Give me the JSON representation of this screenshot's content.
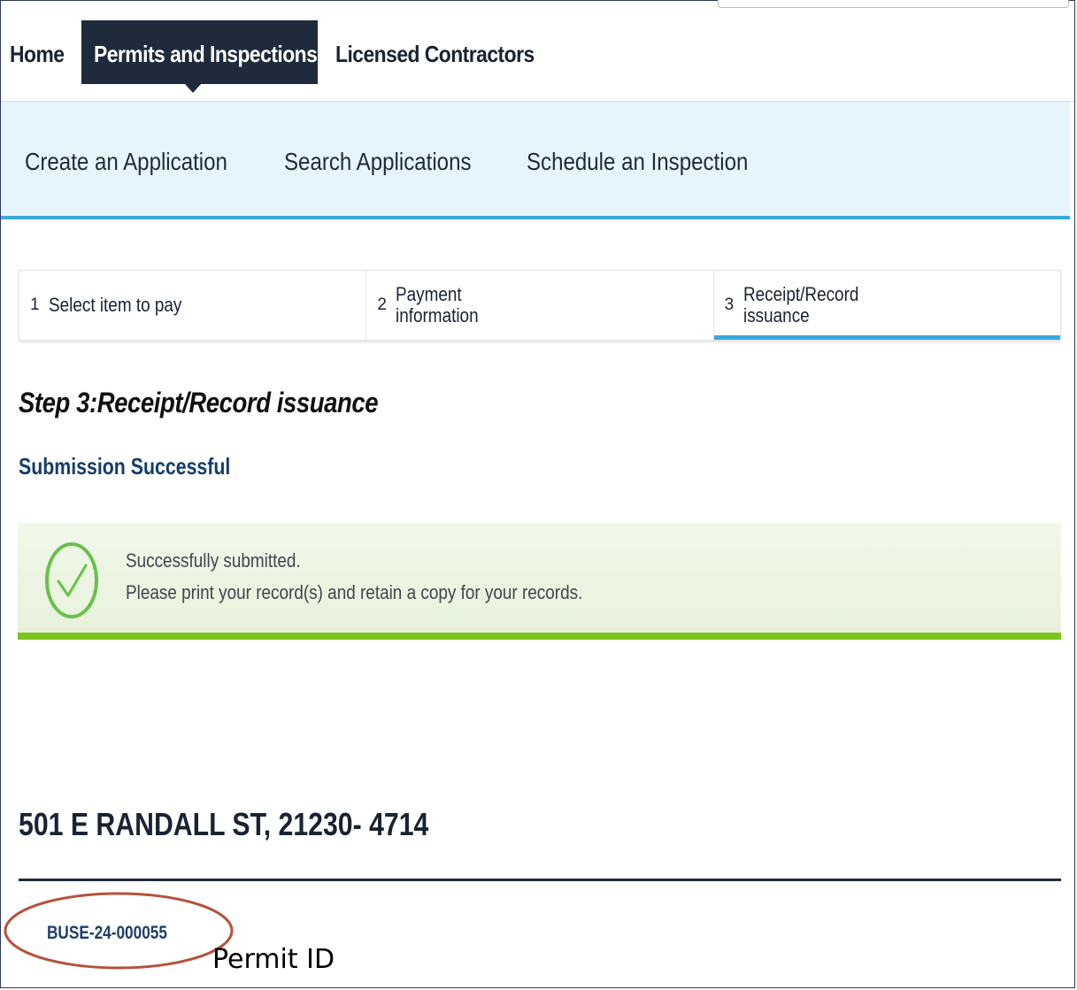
{
  "top_nav": {
    "items": [
      {
        "label": "Home"
      },
      {
        "label": "Permits and Inspections"
      },
      {
        "label": "Licensed Contractors"
      }
    ]
  },
  "sub_nav": {
    "items": [
      {
        "label": "Create an Application"
      },
      {
        "label": "Search Applications"
      },
      {
        "label": "Schedule an Inspection"
      }
    ]
  },
  "steps": [
    {
      "number": "1",
      "label": "Select item to pay"
    },
    {
      "number": "2",
      "label": "Payment information"
    },
    {
      "number": "3",
      "label": "Receipt/Record issuance"
    }
  ],
  "step_title": "Step 3:Receipt/Record issuance",
  "success_heading": "Submission Successful",
  "success_message": {
    "line1": "Successfully submitted.",
    "line2": "Please print your record(s) and retain a copy for your records."
  },
  "address": "501 E RANDALL ST, 21230- 4714",
  "permit_id": "BUSE-24-000055",
  "annotation": {
    "label": "Permit ID"
  },
  "colors": {
    "nav_active_bg": "#1f2a3c",
    "subnav_bg": "#e6f4fb",
    "accent_blue": "#3aa9dc",
    "success_green": "#7cc520",
    "annotation_ellipse": "#b5523b"
  }
}
